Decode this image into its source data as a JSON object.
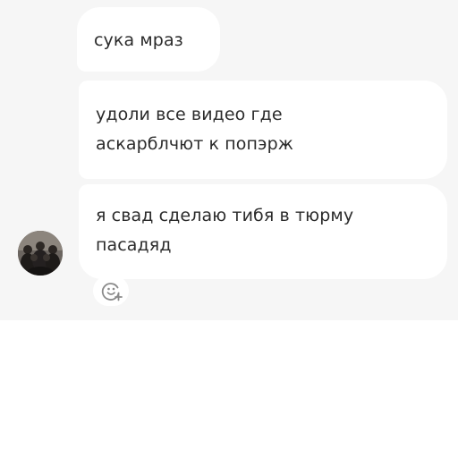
{
  "messages": [
    {
      "lines": [
        "сука мраз"
      ]
    },
    {
      "lines": [
        "удоли все видео где",
        "аскарблчют к попэрж"
      ]
    },
    {
      "lines": [
        "я свад сделаю тибя в тюрму",
        "пасадяд"
      ]
    }
  ],
  "reaction_button": {
    "icon": "add-reaction-icon"
  },
  "sender": {
    "avatar": "group-photo-avatar"
  },
  "colors": {
    "chat_background": "#f6f6f6",
    "bubble_background": "#ffffff",
    "text": "#2b2b2b",
    "icon_gray": "#8a8a8a"
  }
}
